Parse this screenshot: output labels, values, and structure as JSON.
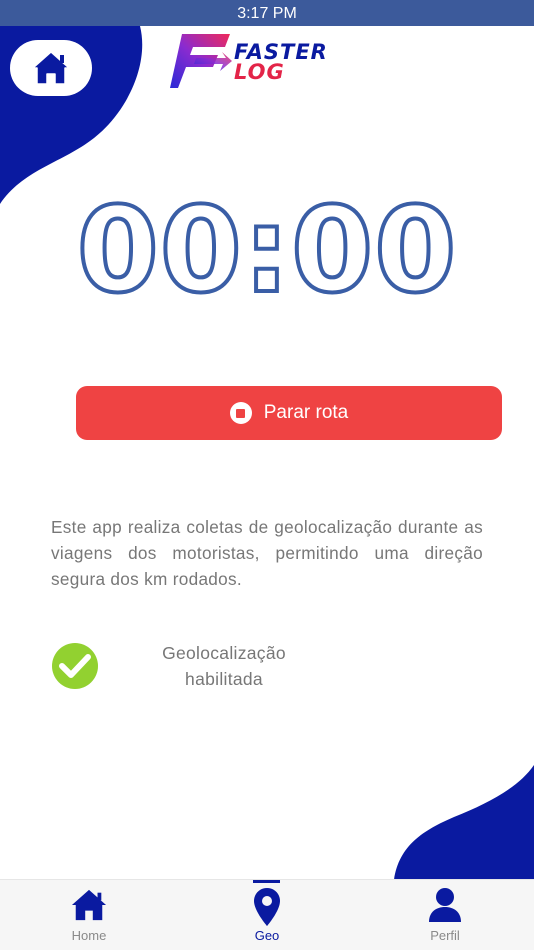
{
  "status_bar": {
    "time": "3:17 PM"
  },
  "header": {
    "logo": {
      "word1": "FASTER",
      "word2": "LOG"
    }
  },
  "timer": {
    "value": "00:00"
  },
  "action": {
    "stop_label": "Parar rota"
  },
  "info": {
    "description": "Este app realiza coletas de geolocalização durante as viagens dos motoristas, permitindo uma direção segura dos km rodados."
  },
  "geo_status": {
    "line1": "Geolocalização",
    "line2": "habilitada"
  },
  "tabs": [
    {
      "label": "Home",
      "icon": "home-icon"
    },
    {
      "label": "Geo",
      "icon": "location-pin-icon"
    },
    {
      "label": "Perfil",
      "icon": "user-icon"
    }
  ],
  "active_tab": "Geo",
  "colors": {
    "brand_blue": "#0a1aa0",
    "status_bar": "#3c5a9b",
    "timer_stroke": "#3a5ea6",
    "stop_button": "#ef4343",
    "check_green": "#92d130",
    "logo_red": "#e32448"
  }
}
